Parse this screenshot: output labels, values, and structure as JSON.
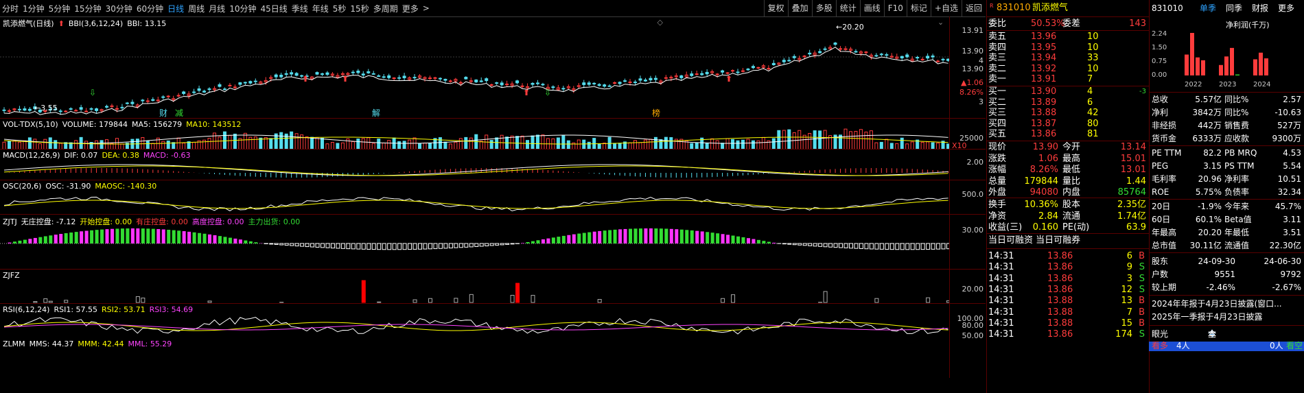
{
  "timeframes": [
    "分时",
    "1分钟",
    "5分钟",
    "15分钟",
    "30分钟",
    "60分钟",
    "日线",
    "周线",
    "月线",
    "10分钟",
    "45日线",
    "季线",
    "年线",
    "5秒",
    "15秒",
    "多周期",
    "更多"
  ],
  "active_timeframe": "日线",
  "more_arrow": ">",
  "tools": [
    "复权",
    "叠加",
    "多股",
    "统计",
    "画线",
    "F10",
    "标记",
    "+自选",
    "返回"
  ],
  "main_chart": {
    "title": "凯添燃气(日线)",
    "arrow": "⬆",
    "indicator": "BBI(3,6,12,24)",
    "bbi_label": "BBI: 13.15",
    "price_high_label": "20.20",
    "price_low_label": "3.55",
    "axis": [
      "13.91",
      "13.90",
      "4",
      "13.90",
      "▲1.06",
      "8.26%",
      "3"
    ],
    "tags": [
      "财",
      "减",
      "解",
      "榜"
    ],
    "tag_x": [
      232,
      255,
      542,
      950
    ],
    "buy_arrow_x": [
      130,
      793
    ],
    "sell_arrow_x": [
      440,
      498,
      762,
      1057
    ]
  },
  "vol": {
    "name": "VOL-TDX(5,10)",
    "volume": "VOLUME: 179844",
    "ma5": "MA5: 156279",
    "ma10": "MA10: 143512",
    "axis_label": "25000",
    "unit": "X10"
  },
  "macd": {
    "name": "MACD(12,26,9)",
    "dif": "DIF: 0.07",
    "dea": "DEA: 0.38",
    "macd": "MACD: -0.63",
    "axis_label": "2.00"
  },
  "osc": {
    "name": "OSC(20,6)",
    "osc": "OSC: -31.90",
    "maosc": "MAOSC: -140.30",
    "axis_label": "500.0"
  },
  "zjtj": {
    "name": "ZJTJ",
    "w": "无庄控盘: -7.12",
    "k": "开始控盘: 0.00",
    "y": "有庄控盘: 0.00",
    "g": "高度控盘: 0.00",
    "z": "主力出货: 0.00",
    "axis_label": "30.00"
  },
  "zjfz": {
    "name": "ZJFZ",
    "axis_label": "20.00"
  },
  "rsi": {
    "name": "RSI(6,12,24)",
    "r1": "RSI1: 57.55",
    "r2": "RSI2: 53.71",
    "r3": "RSI3: 54.69",
    "axis": [
      "100.00",
      "80.00",
      "50.00"
    ]
  },
  "zlmm": {
    "name": "ZLMM",
    "mms": "MMS: 44.37",
    "mmm": "MMM: 42.44",
    "mml": "MML: 55.29"
  },
  "quote": {
    "code": "831010",
    "name": "凯添燃气",
    "prefix": "R",
    "wb_label": "委比",
    "wb_value": "50.53%",
    "wc_label": "委差",
    "wc_value": "143",
    "asks": [
      {
        "l": "卖五",
        "p": "13.96",
        "v": "10"
      },
      {
        "l": "卖四",
        "p": "13.95",
        "v": "10"
      },
      {
        "l": "卖三",
        "p": "13.94",
        "v": "33"
      },
      {
        "l": "卖二",
        "p": "13.92",
        "v": "10"
      },
      {
        "l": "卖一",
        "p": "13.91",
        "v": "7"
      }
    ],
    "bids": [
      {
        "l": "买一",
        "p": "13.90",
        "v": "4",
        "d": "-3"
      },
      {
        "l": "买二",
        "p": "13.89",
        "v": "6",
        "d": ""
      },
      {
        "l": "买三",
        "p": "13.88",
        "v": "42",
        "d": ""
      },
      {
        "l": "买四",
        "p": "13.87",
        "v": "80",
        "d": ""
      },
      {
        "l": "买五",
        "p": "13.86",
        "v": "81",
        "d": ""
      }
    ],
    "stats": [
      {
        "a": "现价",
        "av": "13.90",
        "b": "今开",
        "bv": "13.14"
      },
      {
        "a": "涨跌",
        "av": "1.06",
        "b": "最高",
        "bv": "15.01"
      },
      {
        "a": "涨幅",
        "av": "8.26%",
        "b": "最低",
        "bv": "13.01"
      },
      {
        "a": "总量",
        "av": "179844",
        "b": "量比",
        "bv": "1.44"
      },
      {
        "a": "外盘",
        "av": "94080",
        "b": "内盘",
        "bv": "85764"
      }
    ],
    "stats2": [
      {
        "a": "换手",
        "av": "10.36%",
        "b": "股本",
        "bv": "2.35亿"
      },
      {
        "a": "净资",
        "av": "2.84",
        "b": "流通",
        "bv": "1.74亿"
      },
      {
        "a": "收益(三)",
        "av": "0.160",
        "b": "PE(动)",
        "bv": "63.9"
      }
    ],
    "margin_title": "当日可融资 当日可融券",
    "ticks": [
      {
        "t": "14:31",
        "p": "13.86",
        "v": "6",
        "s": "B"
      },
      {
        "t": "14:31",
        "p": "13.86",
        "v": "9",
        "s": "S"
      },
      {
        "t": "14:31",
        "p": "13.86",
        "v": "3",
        "s": "S"
      },
      {
        "t": "14:31",
        "p": "13.86",
        "v": "12",
        "s": "S"
      },
      {
        "t": "14:31",
        "p": "13.88",
        "v": "13",
        "s": "B"
      },
      {
        "t": "14:31",
        "p": "13.88",
        "v": "7",
        "s": "B"
      },
      {
        "t": "14:31",
        "p": "13.88",
        "v": "15",
        "s": "B"
      },
      {
        "t": "14:31",
        "p": "13.86",
        "v": "174",
        "s": "S"
      }
    ]
  },
  "fund": {
    "code": "831010",
    "tabs": [
      "单季",
      "同季",
      "财报",
      "更多"
    ],
    "chart_title": "净利润(千万)",
    "chart_axis": [
      "2.24",
      "1.50",
      "0.75",
      "0.00"
    ],
    "years": [
      "2022",
      "2023",
      "2024"
    ],
    "chart_data": {
      "type": "bar",
      "categories": [
        "2022",
        "2023",
        "2024"
      ],
      "series": [
        {
          "values": [
            1.1,
            2.24,
            0.95,
            0.8,
            0.55,
            1.0,
            1.45,
            0.05,
            0.85,
            1.2,
            0.9
          ]
        }
      ],
      "ylim": [
        0,
        2.24
      ]
    },
    "rows1": [
      {
        "a": "总收",
        "av": "5.57亿",
        "b": "同比%",
        "bv": "2.57"
      },
      {
        "a": "净利",
        "av": "3842万",
        "b": "同比%",
        "bv": "-10.63"
      },
      {
        "a": "非经损",
        "av": "442万",
        "b": "销售费",
        "bv": "527万"
      },
      {
        "a": "货币金",
        "av": "6333万",
        "b": "应收款",
        "bv": "9300万"
      }
    ],
    "rows2": [
      {
        "a": "PE TTM",
        "av": "82.2",
        "b": "PB MRQ",
        "bv": "4.53"
      },
      {
        "a": "PEG",
        "av": "3.15",
        "b": "PS TTM",
        "bv": "5.54"
      },
      {
        "a": "毛利率",
        "av": "20.96",
        "b": "净利率",
        "bv": "10.51"
      },
      {
        "a": "ROE",
        "av": "5.75%",
        "b": "负债率",
        "bv": "32.34"
      }
    ],
    "rows3": [
      {
        "a": "20日",
        "av": "-1.9%",
        "b": "今年来",
        "bv": "45.7%"
      },
      {
        "a": "60日",
        "av": "60.1%",
        "b": "Beta值",
        "bv": "3.11"
      },
      {
        "a": "年最高",
        "av": "20.20",
        "b": "年最低",
        "bv": "3.51"
      },
      {
        "a": "总市值",
        "av": "30.11亿",
        "b": "流通值",
        "bv": "22.30亿"
      }
    ],
    "holders": [
      {
        "a": "股东",
        "av": "24-09-30",
        "bv": "24-06-30"
      },
      {
        "a": "户数",
        "av": "9551",
        "bv": "9792"
      },
      {
        "a": "较上期",
        "av": "-2.46%",
        "bv": "-2.67%"
      }
    ],
    "notes": [
      "2024年年报于4月23日披露(窗口...",
      "2025年一季报于4月23日披露"
    ],
    "eye": {
      "label": "眼光",
      "tabs": [
        "今日",
        "本周",
        "本月",
        "全年"
      ]
    },
    "bottom": {
      "a": "看多",
      "av": "4人",
      "b": "0人",
      "bv": "看空"
    }
  }
}
